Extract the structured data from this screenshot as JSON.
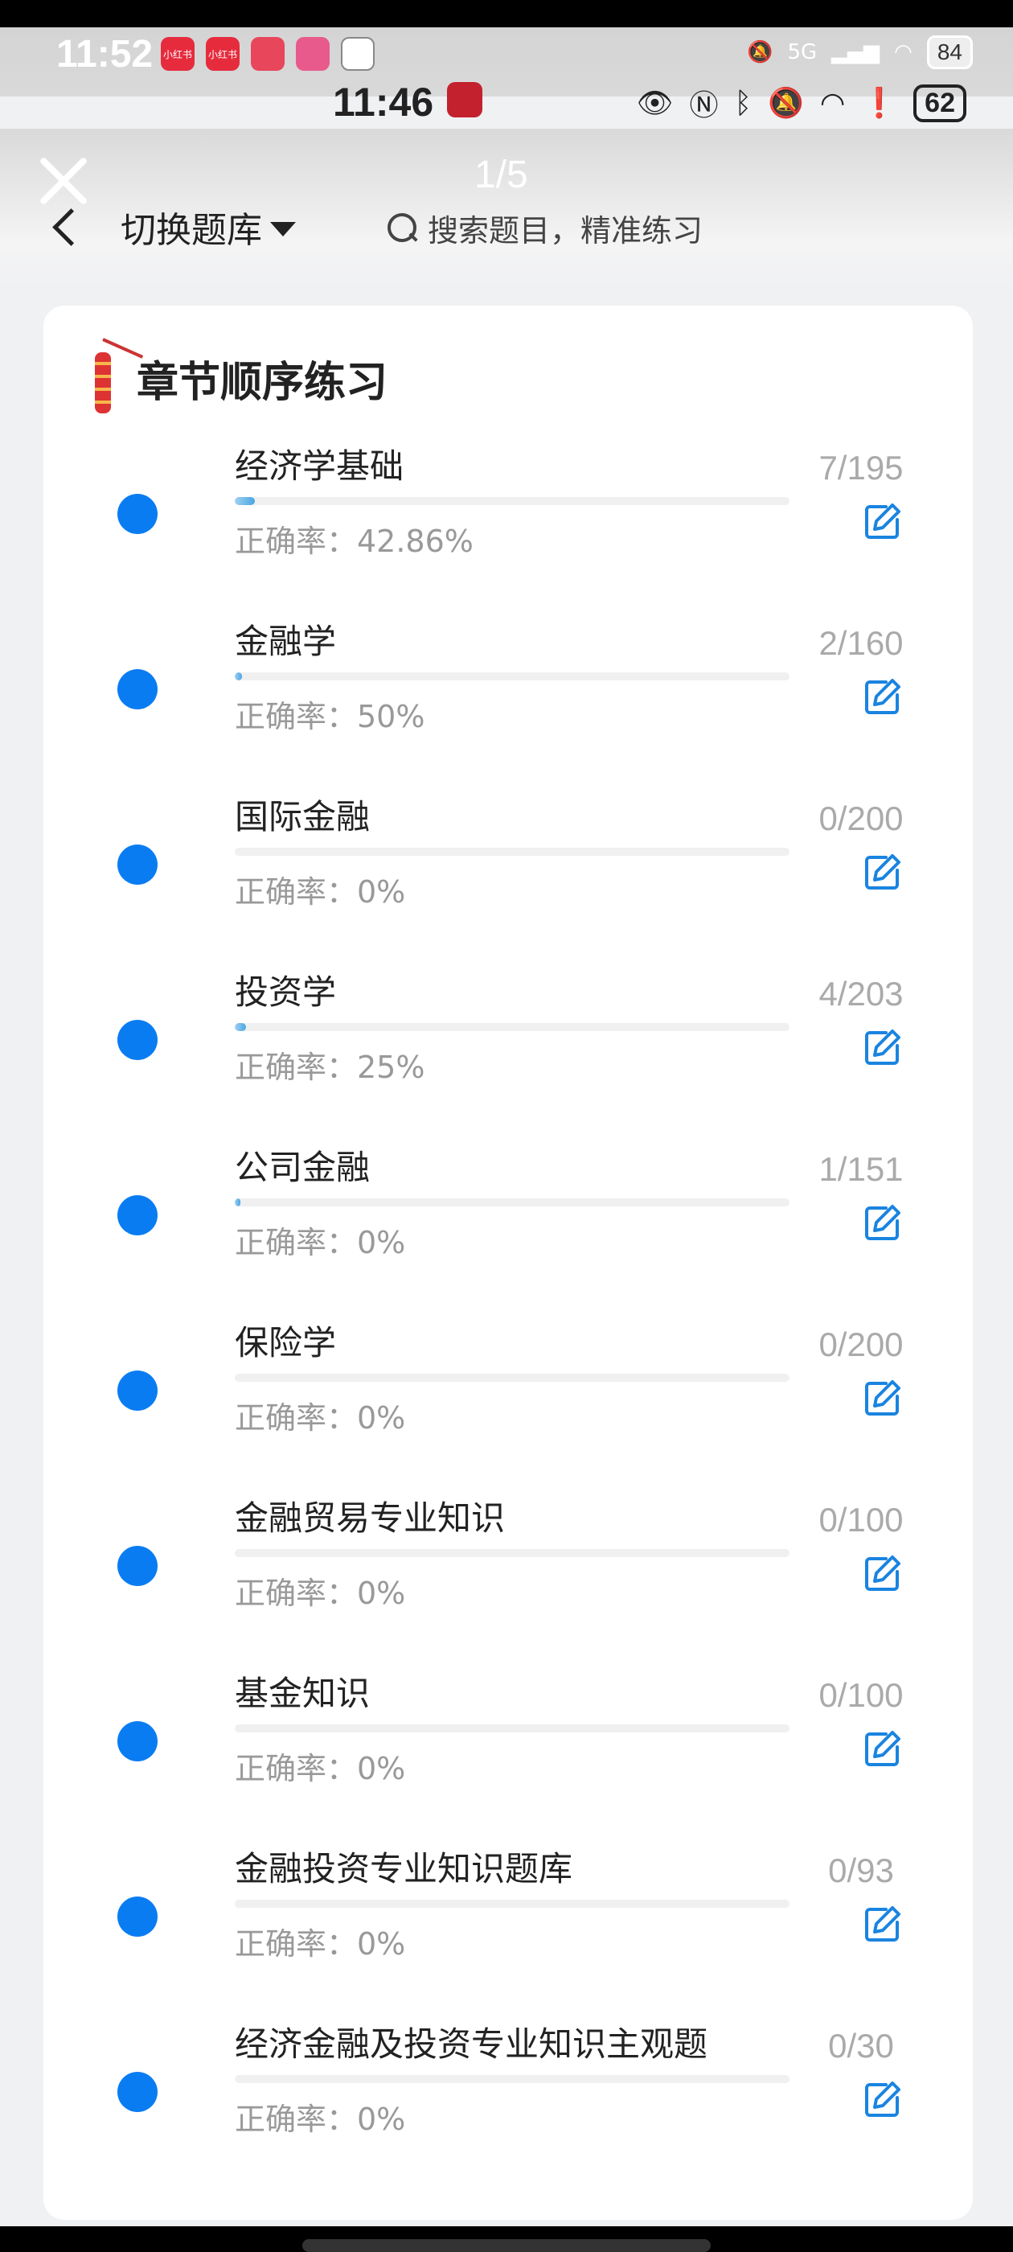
{
  "status_outer": {
    "time": "11:52",
    "apps": [
      {
        "name": "小红书",
        "color": "#e62b3d"
      },
      {
        "name": "小红书",
        "color": "#e62b3d"
      },
      {
        "name": "",
        "color": "#e8465a"
      },
      {
        "name": "",
        "color": "#e85a8c"
      },
      {
        "name": "",
        "color": "#ffffff"
      }
    ],
    "network": "5G",
    "battery": "84"
  },
  "status_inner": {
    "time": "11:46",
    "battery": "62"
  },
  "header": {
    "page_indicator": "1/5",
    "switch_bank_label": "切换题库",
    "search_placeholder": "搜索题目，精准练习"
  },
  "section": {
    "title": "章节顺序练习"
  },
  "accuracy_label": "正确率：",
  "chapters": [
    {
      "name": "经济学基础",
      "count": "7/195",
      "progress": 0.036,
      "accuracy": "正确率：42.86%"
    },
    {
      "name": "金融学",
      "count": "2/160",
      "progress": 0.0125,
      "accuracy": "正确率：50%"
    },
    {
      "name": "国际金融",
      "count": "0/200",
      "progress": 0,
      "accuracy": "正确率：0%"
    },
    {
      "name": "投资学",
      "count": "4/203",
      "progress": 0.02,
      "accuracy": "正确率：25%"
    },
    {
      "name": "公司金融",
      "count": "1/151",
      "progress": 0.0066,
      "accuracy": "正确率：0%"
    },
    {
      "name": "保险学",
      "count": "0/200",
      "progress": 0,
      "accuracy": "正确率：0%"
    },
    {
      "name": "金融贸易专业知识",
      "count": "0/100",
      "progress": 0,
      "accuracy": "正确率：0%"
    },
    {
      "name": "基金知识",
      "count": "0/100",
      "progress": 0,
      "accuracy": "正确率：0%"
    },
    {
      "name": "金融投资专业知识题库",
      "count": "0/93",
      "progress": 0,
      "accuracy": "正确率：0%"
    },
    {
      "name": "经济金融及投资专业知识主观题",
      "count": "0/30",
      "progress": 0,
      "accuracy": "正确率：0%"
    }
  ],
  "colors": {
    "accent": "#0a7cf2",
    "count_text": "#aaaaaa",
    "edit_icon": "#1a84e0"
  },
  "icons": {
    "edit": "edit-icon",
    "search": "search-icon",
    "back": "chevron-left-icon",
    "close": "close-icon",
    "dropdown": "caret-down-icon"
  }
}
